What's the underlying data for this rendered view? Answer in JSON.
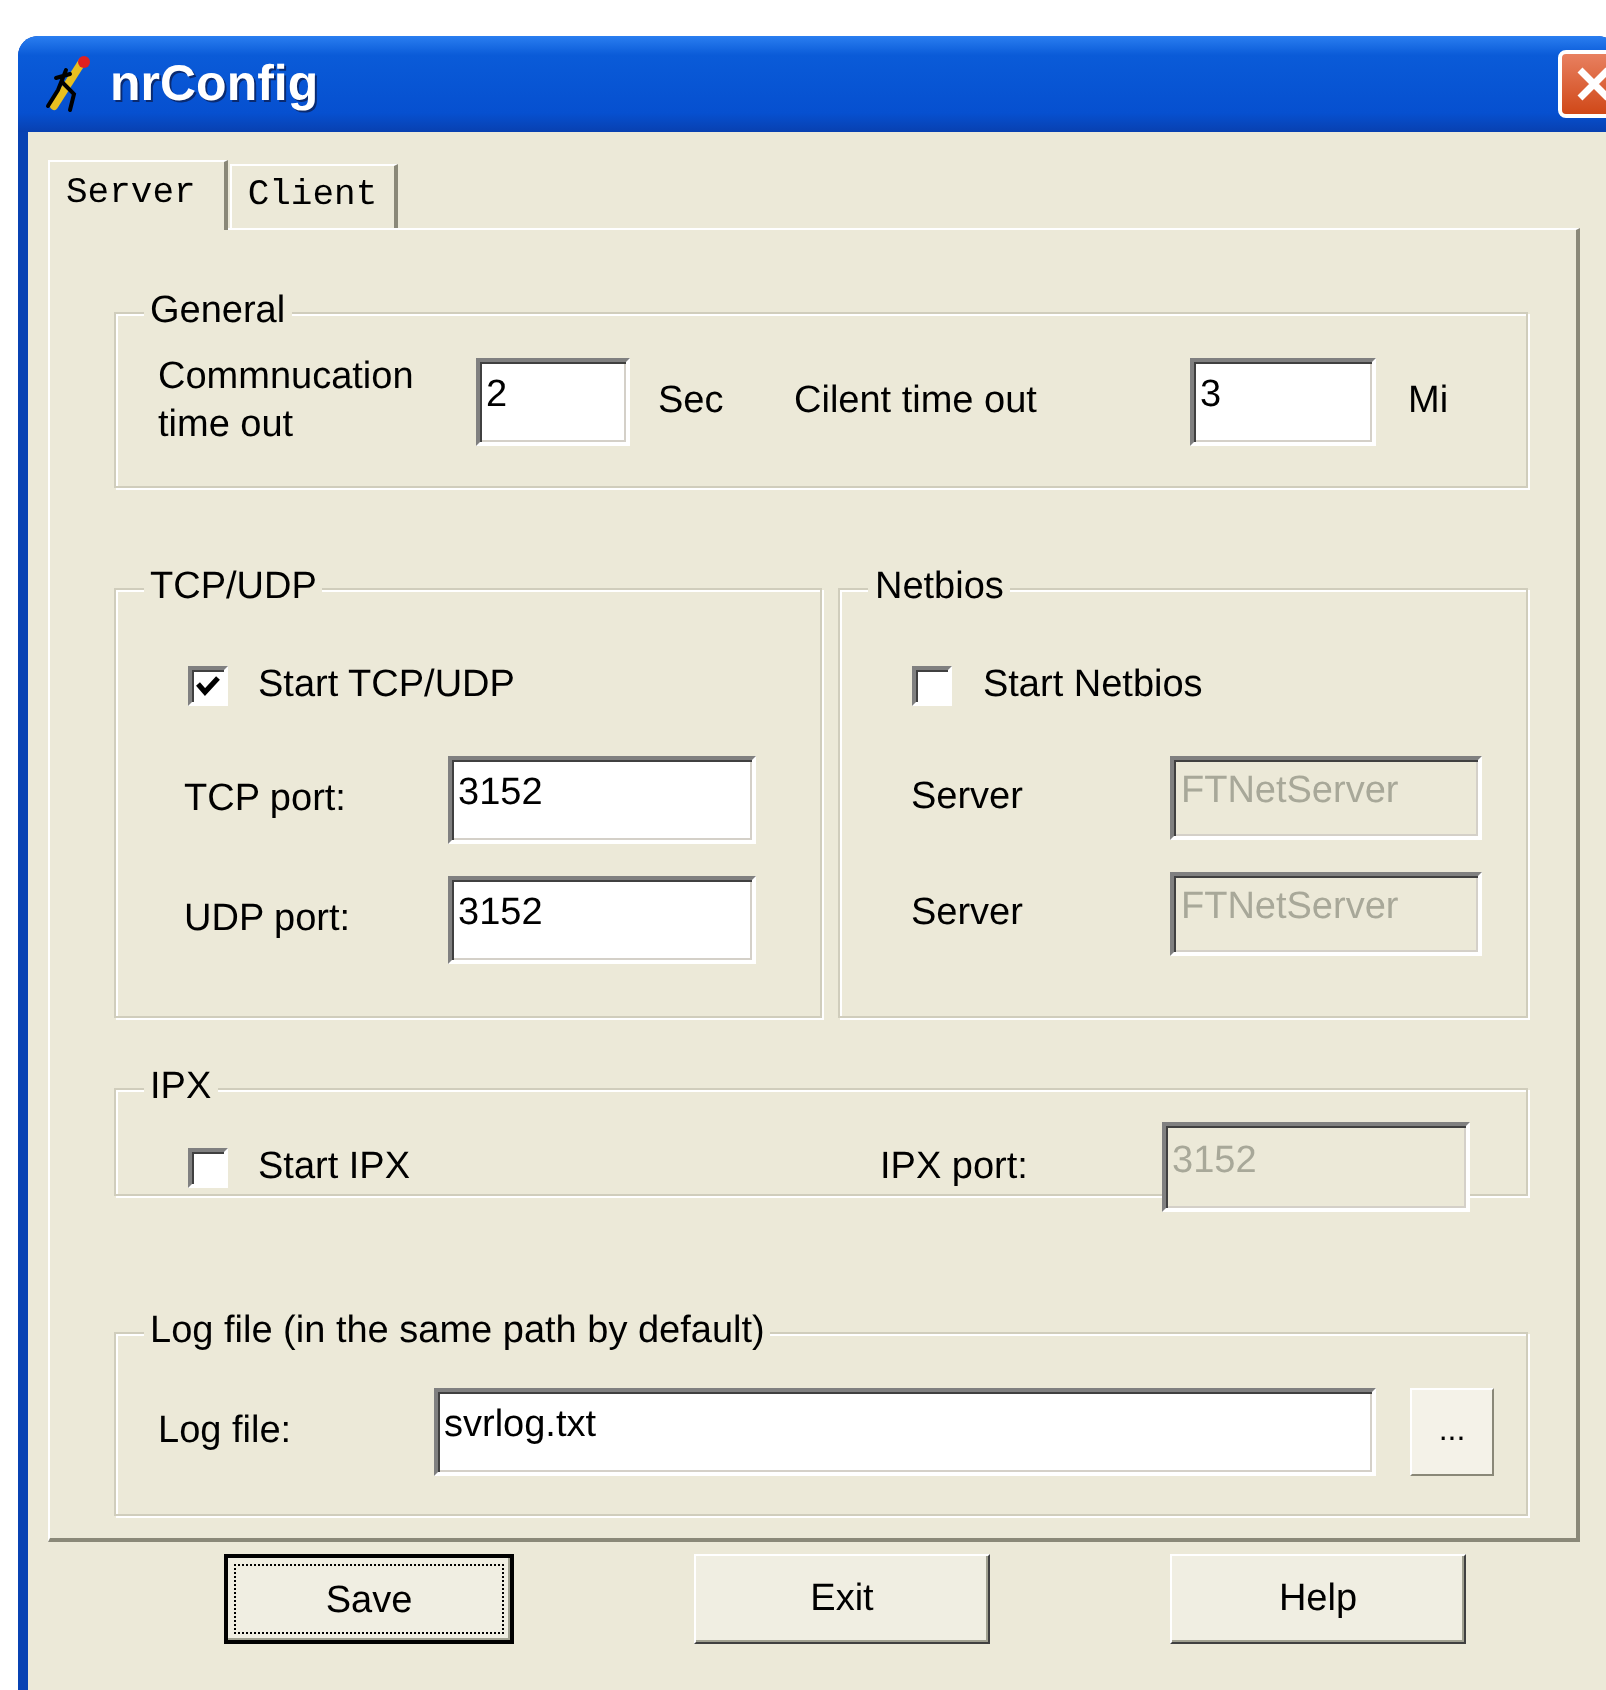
{
  "window": {
    "title": "nrConfig"
  },
  "tabs": [
    {
      "label": "Server",
      "selected": true
    },
    {
      "label": "Client",
      "selected": false
    }
  ],
  "general": {
    "legend": "General",
    "fields": [
      {
        "label": "Commnucation time out",
        "value": "2",
        "unit": "Sec"
      },
      {
        "label": "Cilent time out",
        "value": "3",
        "unit": "Mi"
      }
    ]
  },
  "tcp_udp": {
    "legend": "TCP/UDP",
    "checkbox": {
      "label": "Start TCP/UDP",
      "checked": true
    },
    "fields": [
      {
        "label": "TCP port:",
        "value": "3152",
        "disabled": false
      },
      {
        "label": "UDP port:",
        "value": "3152",
        "disabled": false
      }
    ]
  },
  "netbios": {
    "legend": "Netbios",
    "checkbox": {
      "label": "Start Netbios",
      "checked": false
    },
    "fields": [
      {
        "label": "Server",
        "value": "FTNetServer",
        "disabled": true
      },
      {
        "label": "Server",
        "value": "FTNetServer",
        "disabled": true
      }
    ]
  },
  "ipx": {
    "legend": "IPX",
    "checkbox": {
      "label": "Start IPX",
      "checked": false
    },
    "field": {
      "label": "IPX port:",
      "value": "3152",
      "disabled": true
    }
  },
  "log": {
    "legend": "Log file (in the same path by default)",
    "label": "Log file:",
    "value": "svrlog.txt",
    "browse": "..."
  },
  "buttons": [
    {
      "label": "Save",
      "focused": true
    },
    {
      "label": "Exit",
      "focused": false
    },
    {
      "label": "Help",
      "focused": false
    }
  ]
}
